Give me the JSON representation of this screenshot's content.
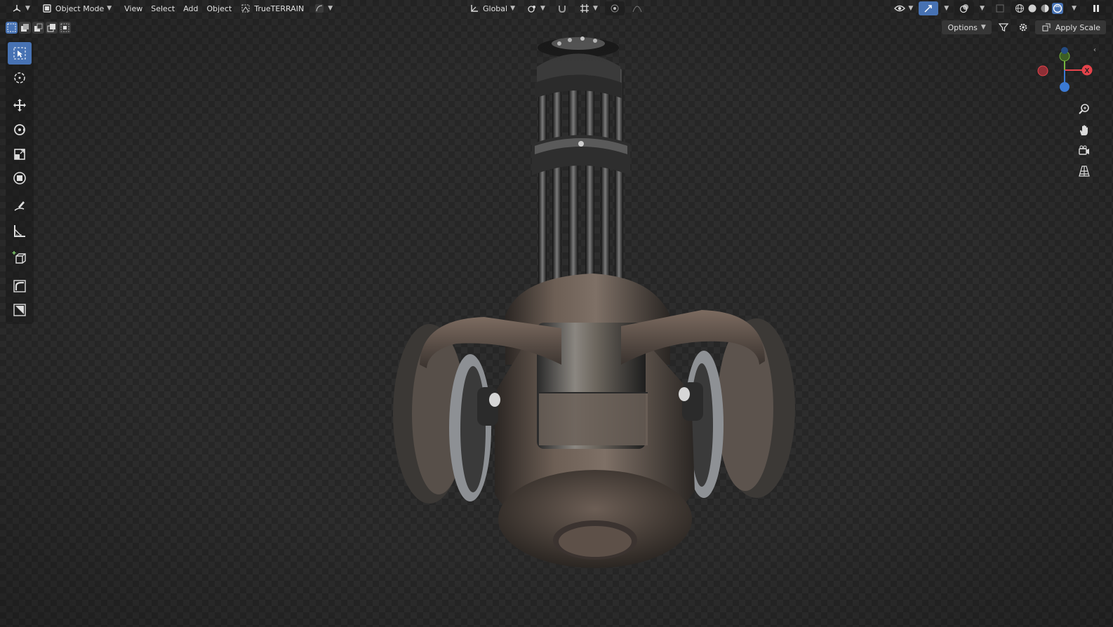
{
  "header": {
    "editor_type_icon": "view3d-editor-icon",
    "mode": "Object Mode",
    "menus": [
      "View",
      "Select",
      "Add",
      "Object"
    ],
    "addon_label": "TrueTERRAIN",
    "transform_orientation": "Global",
    "right_icons": [
      "visibility-icon",
      "gizmo-toggle-icon",
      "overlay-icon",
      "xray-icon",
      "wireframe-shading-icon",
      "solid-shading-icon",
      "material-shading-icon",
      "rendered-shading-icon",
      "pause-icon"
    ]
  },
  "row2": {
    "options_label": "Options",
    "apply_scale_label": "Apply Scale",
    "selection_modes": [
      "select-new-icon",
      "select-extend-icon",
      "select-subtract-icon",
      "select-invert-icon",
      "select-intersect-icon"
    ]
  },
  "toolbar": {
    "tools": [
      "select-box-icon",
      "cursor-icon",
      "move-icon",
      "rotate-icon",
      "scale-icon",
      "transform-icon",
      "annotate-icon",
      "measure-icon",
      "add-cube-icon",
      "shear-icon",
      "extra-tool-icon"
    ],
    "active_tool": "select-box-icon"
  },
  "gizmo": {
    "x_label": "X",
    "colors": {
      "x": "#e5434b",
      "y": "#75b53f",
      "z": "#3b7ad4"
    }
  },
  "viewport": {
    "object": "minigun-model"
  }
}
